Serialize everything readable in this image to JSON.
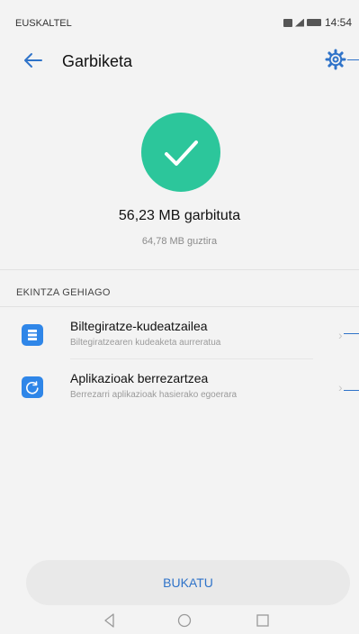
{
  "status_bar": {
    "carrier": "EUSKALTEL",
    "time": "14:54"
  },
  "app_bar": {
    "title": "Garbiketa",
    "back_icon": "arrow-left-icon",
    "settings_icon": "gear-icon"
  },
  "result": {
    "cleaned_text": "56,23 MB garbituta",
    "total_text": "64,78 MB guztira",
    "status_icon": "check-icon"
  },
  "more_actions": {
    "title": "EKINTZA GEHIAGO",
    "items": [
      {
        "label": "Biltegiratze-kudeatzailea",
        "description": "Biltegiratzearen kudeaketa aurreratua",
        "icon": "storage-icon"
      },
      {
        "label": "Aplikazioak berrezartzea",
        "description": "Berrezarri aplikazioak hasierako egoerara",
        "icon": "reset-icon"
      }
    ]
  },
  "footer": {
    "done_label": "BUKATU"
  },
  "system_nav": {
    "back_icon": "triangle-back-icon",
    "home_icon": "circle-home-icon",
    "recents_icon": "square-recents-icon"
  },
  "colors": {
    "accent": "#2f73c9",
    "success": "#2cc69b",
    "background": "#f3f3f3"
  }
}
